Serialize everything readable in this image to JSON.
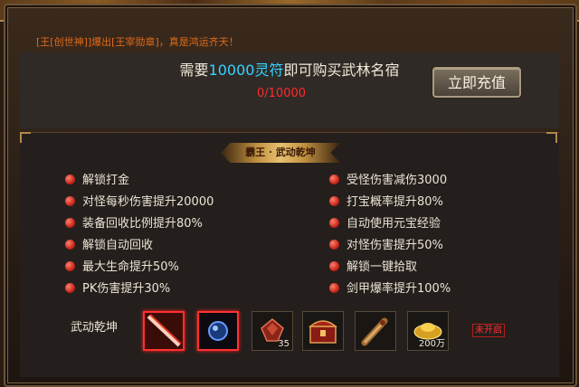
{
  "marquee": "[王[创世神]]爆出[王宰勋章]，真是鸿运齐天！",
  "buy": {
    "prefix": "需要",
    "amount": "10000灵符",
    "suffix": "即可购买武林名宿"
  },
  "progress": "0/10000",
  "recharge_button": "立即充值",
  "title": "霸王 · 武动乾坤",
  "perks_left": [
    "解锁打金",
    "对怪每秒伤害提升20000",
    "装备回收比例提升80%",
    "解锁自动回收",
    "最大生命提升50%",
    "PK伤害提升30%"
  ],
  "perks_right": [
    "受怪伤害减伤3000",
    "打宝概率提升80%",
    "自动使用元宝经验",
    "对怪伤害提升50%",
    "解锁一键拾取",
    "剑甲爆率提升100%"
  ],
  "skill_label": "武动乾坤",
  "items": [
    {
      "icon": "sword-effect-icon",
      "qty": ""
    },
    {
      "icon": "blue-orb-icon",
      "qty": ""
    },
    {
      "icon": "red-gem-icon",
      "qty": "35"
    },
    {
      "icon": "treasure-chest-icon",
      "qty": ""
    },
    {
      "icon": "scroll-icon",
      "qty": ""
    },
    {
      "icon": "gold-ingot-icon",
      "qty": "200万"
    }
  ],
  "status_badge": "未开启",
  "colors": {
    "accent_cyan": "#37d3ff",
    "progress_red": "#ff2a2a",
    "marquee_orange": "#e06a1a"
  }
}
